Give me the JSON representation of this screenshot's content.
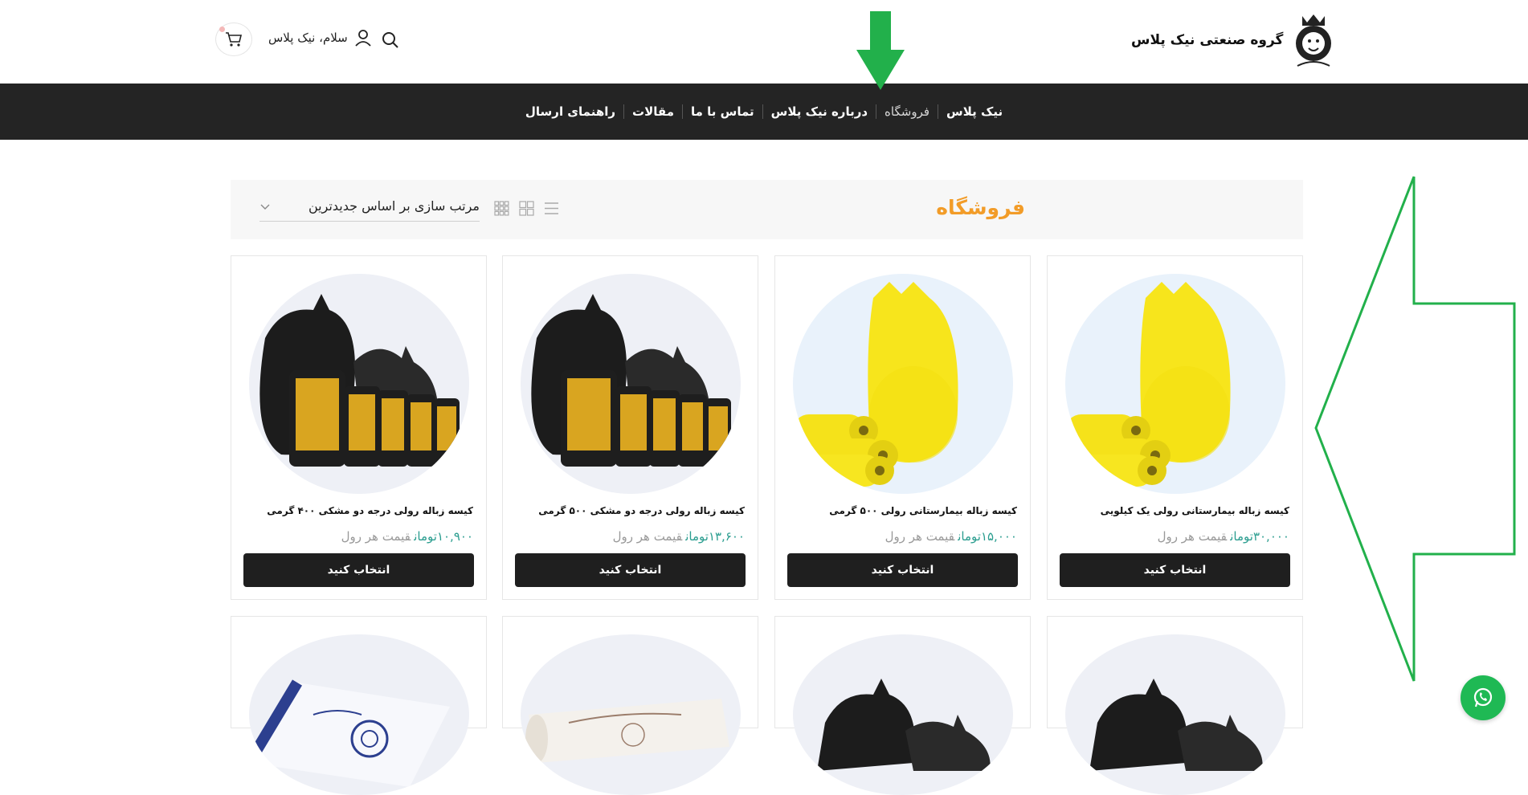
{
  "header": {
    "logo_text": "گروه صنعتی نیک پلاس",
    "greeting": "سلام، نیک پلاس",
    "cart_count": "0"
  },
  "nav": {
    "items": [
      {
        "label": "نیک پلاس"
      },
      {
        "label": "فروشگاه",
        "active": true
      },
      {
        "label": "درباره نیک پلاس"
      },
      {
        "label": "تماس با ما"
      },
      {
        "label": "مقالات"
      },
      {
        "label": "راهنمای ارسال"
      }
    ]
  },
  "toolbar": {
    "title": "فروشگاه",
    "sort_label": "مرتب سازی بر اساس جدیدترین"
  },
  "products": [
    {
      "title": "کیسه زباله بیمارستانی رولی یک کیلویی",
      "price": "۳۰,۰۰۰تومان",
      "price_note": "قیمت هر رول",
      "button": "انتخاب کنید",
      "color": "yellow"
    },
    {
      "title": "کیسه زباله بیمارستانی رولی ۵۰۰ گرمی",
      "price": "۱۵,۰۰۰تومان",
      "price_note": "قیمت هر رول",
      "button": "انتخاب کنید",
      "color": "yellow"
    },
    {
      "title": "کیسه زباله رولی درجه دو مشکی ۵۰۰ گرمی",
      "price": "۱۳,۶۰۰تومان",
      "price_note": "قیمت هر رول",
      "button": "انتخاب کنید",
      "color": "black"
    },
    {
      "title": "کیسه زباله رولی درجه دو مشکی ۴۰۰ گرمی",
      "price": "۱۰,۹۰۰تومان",
      "price_note": "قیمت هر رول",
      "button": "انتخاب کنید",
      "color": "black"
    }
  ],
  "colors": {
    "accent": "#f29c28",
    "nav_bg": "#242424",
    "price": "#2a9d8f",
    "button": "#1f1f1f",
    "annotation": "#22b04b",
    "whatsapp": "#1fb954"
  }
}
